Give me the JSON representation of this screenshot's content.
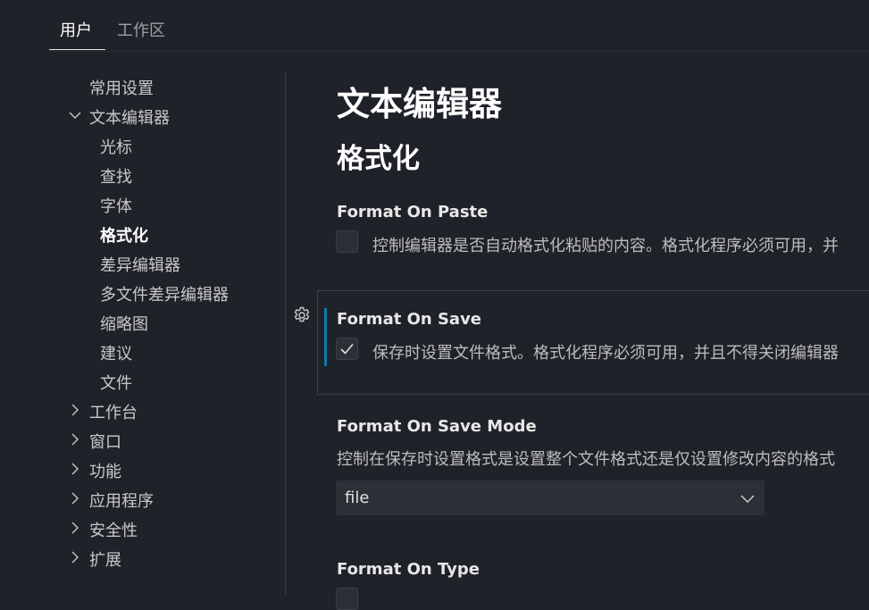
{
  "tabs": [
    {
      "label": "用户"
    },
    {
      "label": "工作区"
    }
  ],
  "sidebar": {
    "items": [
      {
        "label": "常用设置"
      },
      {
        "label": "文本编辑器"
      },
      {
        "label": "光标"
      },
      {
        "label": "查找"
      },
      {
        "label": "字体"
      },
      {
        "label": "格式化"
      },
      {
        "label": "差异编辑器"
      },
      {
        "label": "多文件差异编辑器"
      },
      {
        "label": "缩略图"
      },
      {
        "label": "建议"
      },
      {
        "label": "文件"
      },
      {
        "label": "工作台"
      },
      {
        "label": "窗口"
      },
      {
        "label": "功能"
      },
      {
        "label": "应用程序"
      },
      {
        "label": "安全性"
      },
      {
        "label": "扩展"
      }
    ]
  },
  "main": {
    "title": "文本编辑器",
    "section": "格式化",
    "settings": {
      "paste": {
        "title": "Format On Paste",
        "desc": "控制编辑器是否自动格式化粘贴的内容。格式化程序必须可用，并",
        "checked": false
      },
      "save": {
        "title": "Format On Save",
        "desc": "保存时设置文件格式。格式化程序必须可用，并且不得关闭编辑器",
        "checked": true
      },
      "save_mode": {
        "title": "Format On Save Mode",
        "desc": "控制在保存时设置格式是设置整个文件格式还是仅设置修改内容的格式",
        "value": "file"
      },
      "type": {
        "title": "Format On Type"
      }
    }
  },
  "icons": {
    "gear": "gear-icon",
    "chevron_down": "chevron-down-icon",
    "chevron_right": "chevron-right-icon",
    "check": "check-icon"
  },
  "colors": {
    "background": "#1f2228",
    "focus_accent": "#0e7aa8",
    "input_bg": "#2c2f36"
  }
}
